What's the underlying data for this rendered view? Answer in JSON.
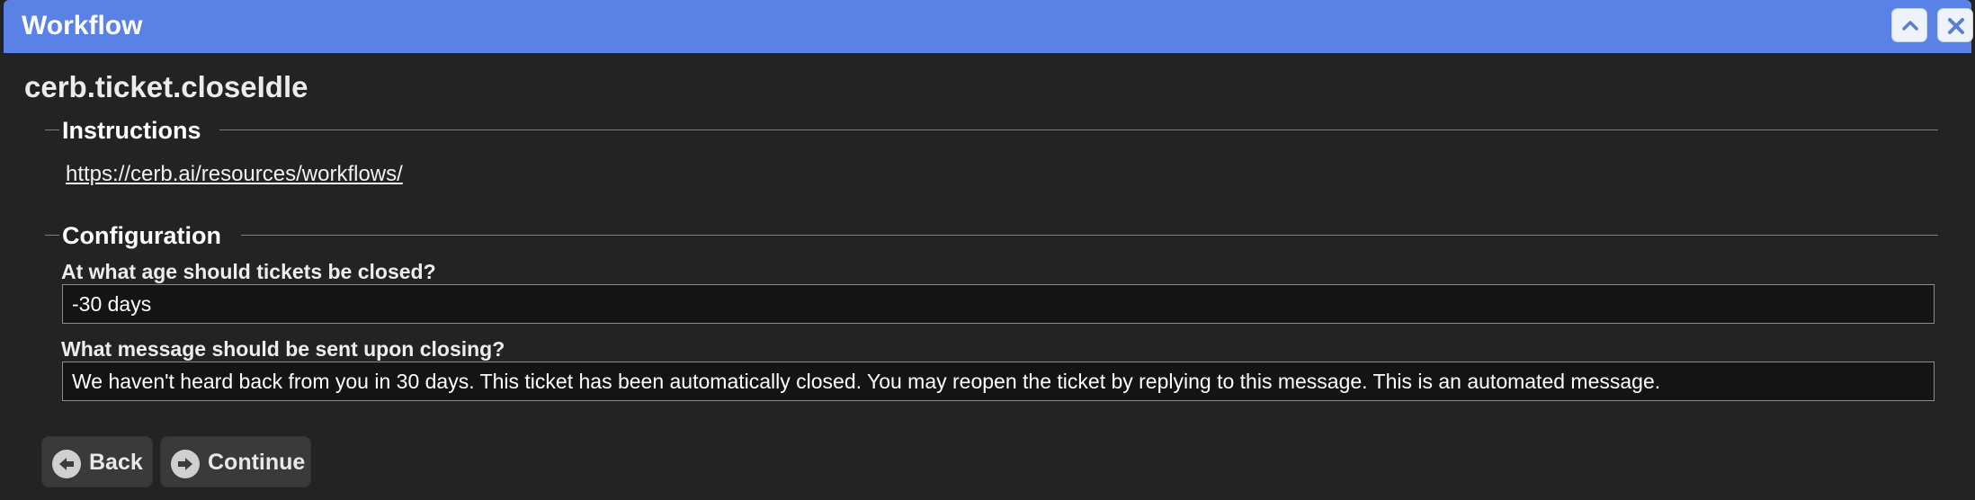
{
  "window": {
    "title": "Workflow",
    "controls": {
      "collapse_icon": "chevron-up-icon",
      "close_icon": "close-icon"
    }
  },
  "page": {
    "title": "cerb.ticket.closeIdle"
  },
  "instructions": {
    "legend": "Instructions",
    "link_text": "https://cerb.ai/resources/workflows/"
  },
  "configuration": {
    "legend": "Configuration",
    "fields": [
      {
        "label": "At what age should tickets be closed?",
        "value": "-30 days"
      },
      {
        "label": "What message should be sent upon closing?",
        "value": "We haven't heard back from you in 30 days. This ticket has been automatically closed. You may reopen the ticket by replying to this message. This is an automated message."
      }
    ]
  },
  "actions": {
    "back_label": "Back",
    "back_icon": "arrow-left-circle-icon",
    "continue_label": "Continue",
    "continue_icon": "arrow-right-circle-icon"
  },
  "colors": {
    "titlebar": "#5a82e6",
    "background": "#232323",
    "input_background": "#141414"
  }
}
